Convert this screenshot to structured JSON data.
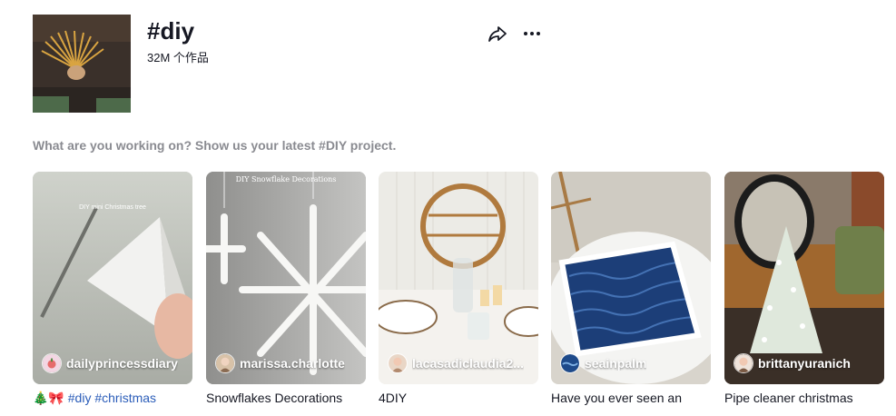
{
  "header": {
    "title": "#diy",
    "count": "32M 个作品",
    "share_icon": "share-arrow-icon",
    "more_icon": "more-horizontal-icon"
  },
  "description": "What are you working on? Show us your latest #DIY project.",
  "videos": [
    {
      "author": "dailyprincessdiary",
      "overlay_text": "DIY mini Christmas tree",
      "caption_prefix": "🎄🎀 ",
      "caption_tags": [
        "#diy",
        "#christmas"
      ],
      "caption": ""
    },
    {
      "author": "marissa.charlotte",
      "overlay_text": "DIY Snowflake Decorations",
      "caption": "Snowflakes Decorations"
    },
    {
      "author": "lacasadiclaudia2...",
      "caption": "4DIY"
    },
    {
      "author": "seainpalm",
      "caption": "Have you ever seen an"
    },
    {
      "author": "brittanyuranich",
      "caption": "Pipe cleaner christmas"
    }
  ],
  "colors": {
    "hashtag": "#2b5db9",
    "description": "#8a8b91",
    "text": "#161823"
  }
}
